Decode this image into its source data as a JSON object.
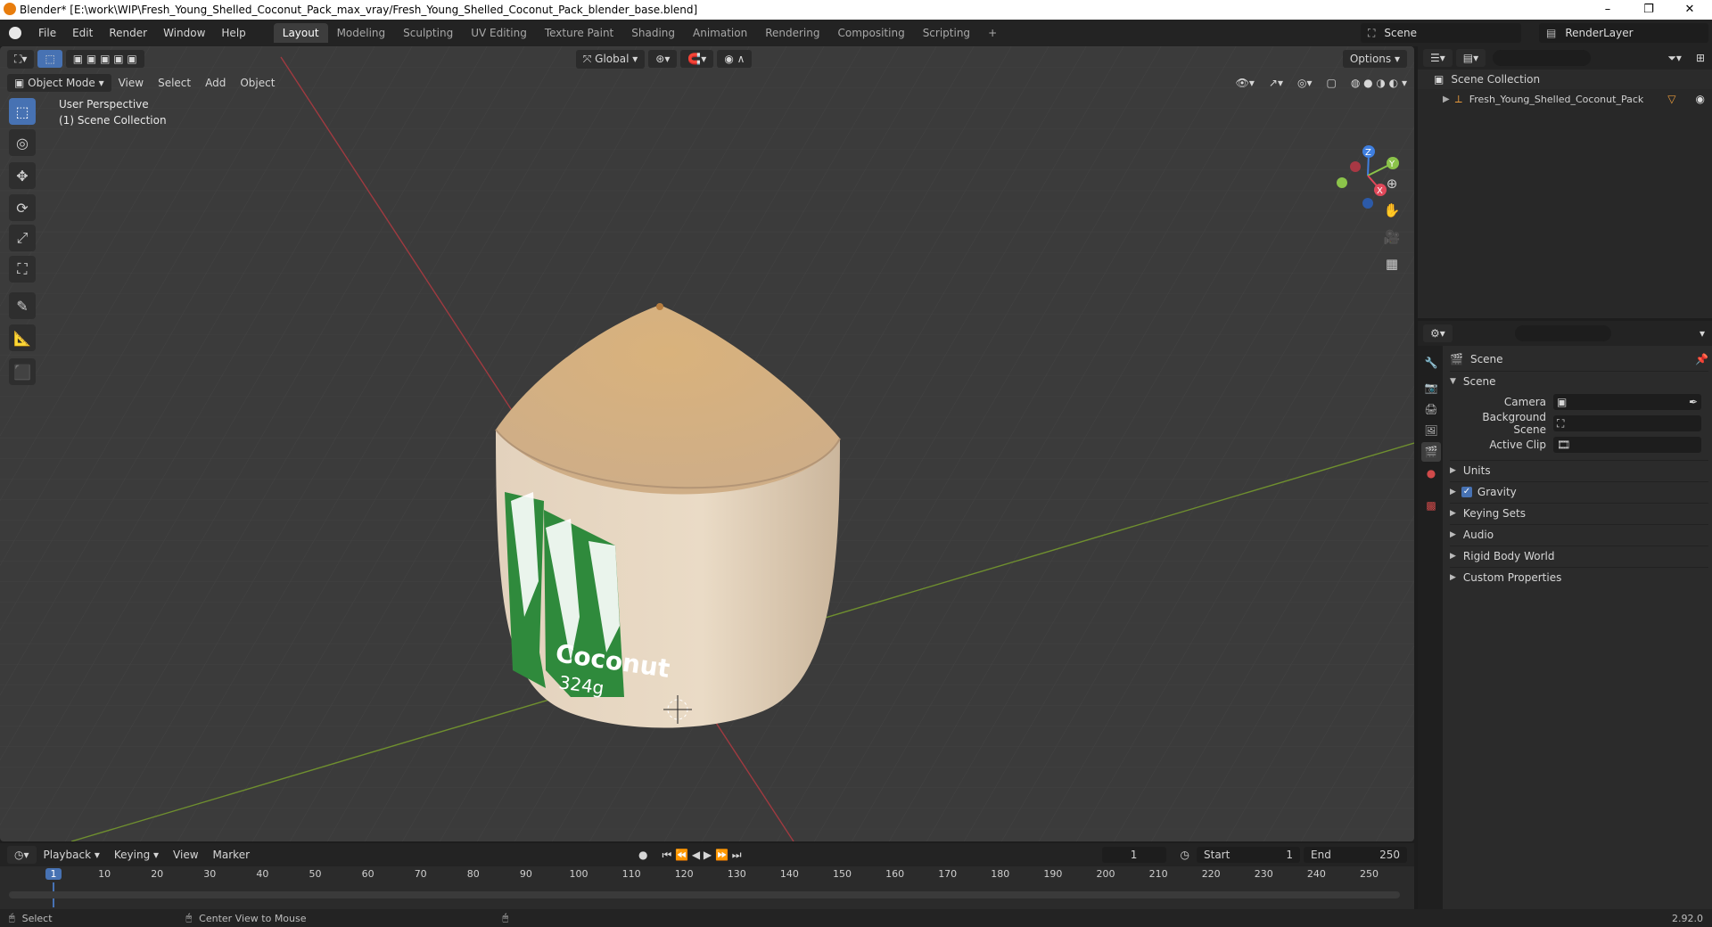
{
  "window": {
    "title": "Blender* [E:\\work\\WIP\\Fresh_Young_Shelled_Coconut_Pack_max_vray/Fresh_Young_Shelled_Coconut_Pack_blender_base.blend]",
    "minimize": "–",
    "maximize": "❐",
    "close": "✕"
  },
  "menu": [
    "File",
    "Edit",
    "Render",
    "Window",
    "Help"
  ],
  "workspaces": [
    "Layout",
    "Modeling",
    "Sculpting",
    "UV Editing",
    "Texture Paint",
    "Shading",
    "Animation",
    "Rendering",
    "Compositing",
    "Scripting"
  ],
  "workspace_add": "+",
  "scene_selector": "Scene",
  "render_layer": "RenderLayer",
  "viewport": {
    "transform_orientation": "Global",
    "options": "Options",
    "mode": "Object Mode",
    "menus": [
      "View",
      "Select",
      "Add",
      "Object"
    ],
    "perspective_label": "User Perspective",
    "collection_label": "(1) Scene Collection",
    "axes": {
      "x": "X",
      "y": "Y",
      "z": "Z"
    }
  },
  "outliner": {
    "root": "Scene Collection",
    "items": [
      {
        "label": "Fresh_Young_Shelled_Coconut_Pack"
      }
    ]
  },
  "properties": {
    "context": "Scene",
    "section": "Scene",
    "fields": [
      {
        "label": "Camera",
        "value": ""
      },
      {
        "label": "Background Scene",
        "value": ""
      },
      {
        "label": "Active Clip",
        "value": ""
      }
    ],
    "panels": [
      "Units",
      "Gravity",
      "Keying Sets",
      "Audio",
      "Rigid Body World",
      "Custom Properties"
    ],
    "gravity_checked": true
  },
  "timeline": {
    "menus": [
      "Playback",
      "Keying",
      "View",
      "Marker"
    ],
    "current_frame": "1",
    "start_label": "Start",
    "start": "1",
    "end_label": "End",
    "end": "250",
    "ruler": [
      "1",
      "10",
      "20",
      "30",
      "40",
      "50",
      "60",
      "70",
      "80",
      "90",
      "100",
      "110",
      "120",
      "130",
      "140",
      "150",
      "160",
      "170",
      "180",
      "190",
      "200",
      "210",
      "220",
      "230",
      "240",
      "250"
    ]
  },
  "status": {
    "left": "Select",
    "middle": "Center View to Mouse",
    "version": "2.92.0"
  },
  "label_text": {
    "line1": "Coconut",
    "line2": "324g"
  },
  "colors": {
    "accent": "#4772b3",
    "axis_x": "#e0485a",
    "axis_y": "#8bc34a",
    "axis_z": "#3f7fe0"
  }
}
